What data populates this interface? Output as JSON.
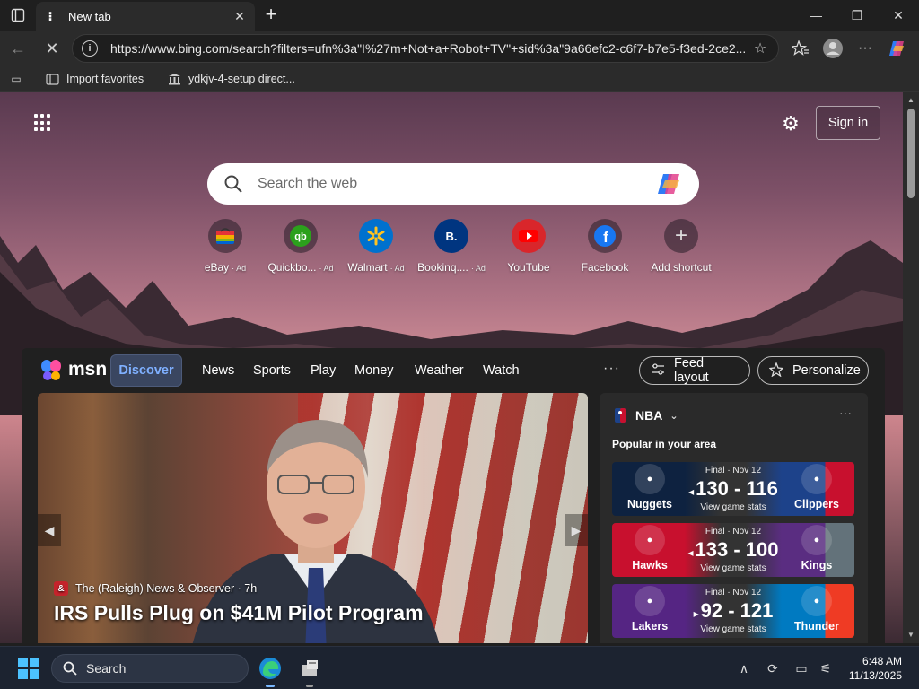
{
  "browser": {
    "tab_title": "New tab",
    "url": "https://www.bing.com/search?filters=ufn%3a\"I%27m+Not+a+Robot+TV\"+sid%3a\"9a66efc2-c6f7-b7e5-f3ed-2ce2...",
    "favorites": [
      {
        "label": "Import favorites"
      },
      {
        "label": "ydkjv-4-setup direct..."
      }
    ]
  },
  "page": {
    "sign_in": "Sign in",
    "search_placeholder": "Search the web",
    "shortcuts": [
      {
        "label": "eBay",
        "ad": "· Ad"
      },
      {
        "label": "Quickbo...",
        "ad": "· Ad"
      },
      {
        "label": "Walmart",
        "ad": "· Ad"
      },
      {
        "label": "Bookinq....",
        "ad": "· Ad"
      },
      {
        "label": "YouTube",
        "ad": ""
      },
      {
        "label": "Facebook",
        "ad": ""
      },
      {
        "label": "Add shortcut",
        "ad": ""
      }
    ]
  },
  "msn": {
    "logo": "msn",
    "nav": [
      "Discover",
      "News",
      "Sports",
      "Play",
      "Money",
      "Weather",
      "Watch"
    ],
    "more": "···",
    "feed_layout": "Feed layout",
    "personalize": "Personalize",
    "hero": {
      "source": "The (Raleigh) News & Observer · 7h",
      "source_badge": "&",
      "headline": "IRS Pulls Plug on $41M Pilot Program"
    },
    "nba": {
      "title": "NBA",
      "subtitle": "Popular in your area",
      "games": [
        {
          "status": "Final · Nov 12",
          "home": "Nuggets",
          "away": "Clippers",
          "score": "130 - 116",
          "winner_arrow": "◂",
          "stats": "View game stats",
          "home_color": "#0e2240",
          "away_color": "#1d428a",
          "accent": "#c8102e"
        },
        {
          "status": "Final · Nov 12",
          "home": "Hawks",
          "away": "Kings",
          "score": "133 - 100",
          "winner_arrow": "◂",
          "stats": "View game stats",
          "home_color": "#c8102e",
          "away_color": "#5a2d81",
          "accent": "#63727a"
        },
        {
          "status": "Final · Nov 12",
          "home": "Lakers",
          "away": "Thunder",
          "score": "92 - 121",
          "winner_arrow": "▸",
          "stats": "View game stats",
          "home_color": "#552583",
          "away_color": "#007ac1",
          "accent": "#ef3b24"
        }
      ]
    }
  },
  "taskbar": {
    "search": "Search",
    "time": "6:48 AM",
    "date": "11/13/2025"
  }
}
